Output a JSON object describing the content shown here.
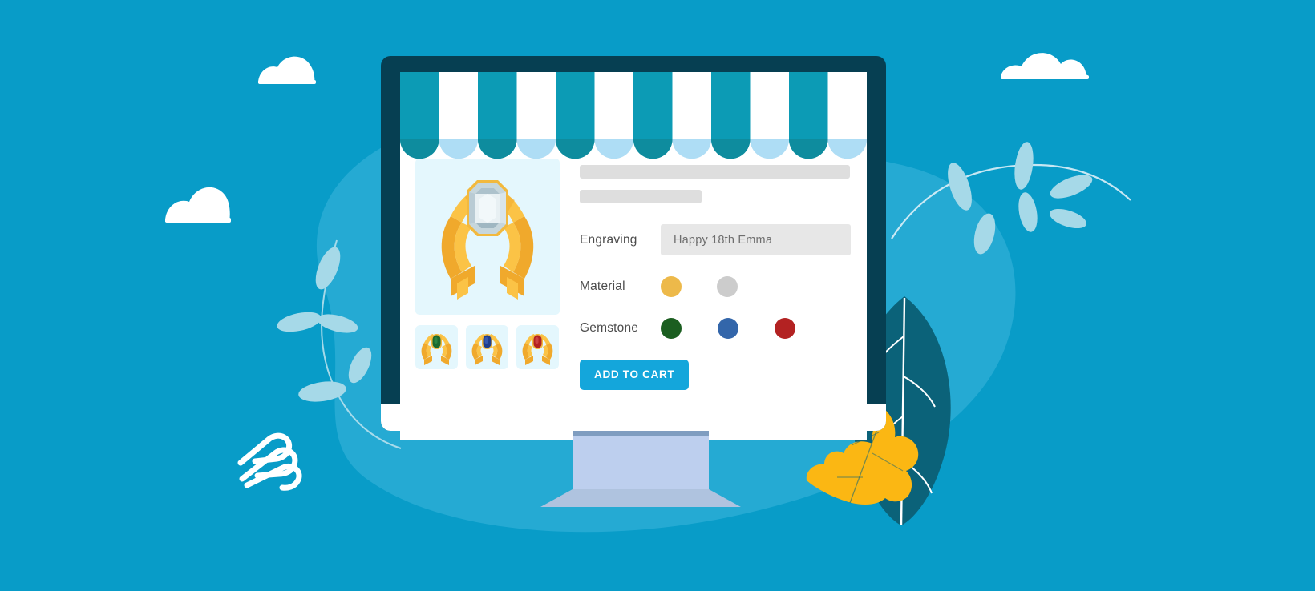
{
  "scene": {
    "title": "Ecommerce product configurator illustration",
    "background_color": "#089CC8",
    "blob_color": "#25AAD3",
    "monitor_bezel_color": "#063F52",
    "screen_color": "#ffffff"
  },
  "storefront": {
    "awning": {
      "stripe_teal": "#0C9BB5",
      "stripe_white": "#FFFFFF",
      "scallop_teal": "#0E8C9E",
      "scallop_blue": "#AEDDF5",
      "stripe_count": 12
    },
    "gallery": {
      "hero_alt": "Gold ring with emerald-cut white diamond",
      "hero_background": "#E4F7FD",
      "thumbnails": [
        {
          "alt": "Gold ring with green emerald gemstone",
          "gem_color": "#1B6A2E"
        },
        {
          "alt": "Gold ring with blue sapphire gemstone",
          "gem_color": "#1F3E8C"
        },
        {
          "alt": "Gold ring with red ruby gemstone",
          "gem_color": "#B32222"
        }
      ]
    },
    "details": {
      "skeleton_title_alt": "Product title placeholder",
      "skeleton_subtitle_alt": "Product price placeholder",
      "options": [
        {
          "label": "Engraving",
          "type": "text",
          "value": "Happy 18th Emma",
          "placeholder": "Happy 18th Emma"
        },
        {
          "label": "Material",
          "type": "swatches",
          "swatches": [
            {
              "name": "gold",
              "color": "#EDB94A"
            },
            {
              "name": "silver",
              "color": "#CCCCCC"
            }
          ]
        },
        {
          "label": "Gemstone",
          "type": "swatches",
          "swatches": [
            {
              "name": "emerald",
              "color": "#1B5E20"
            },
            {
              "name": "sapphire",
              "color": "#3366AA"
            },
            {
              "name": "ruby",
              "color": "#B32222"
            }
          ]
        }
      ],
      "add_to_cart_label": "ADD TO CART",
      "add_to_cart_color": "#14A6DB"
    }
  },
  "decor": {
    "clouds": 3,
    "leaf_large_color": "#0B6279",
    "leaf_yellow_color": "#FBB713",
    "sprig_color": "#A6D9E8",
    "logo_alt": "Abstract white wave logo mark"
  }
}
